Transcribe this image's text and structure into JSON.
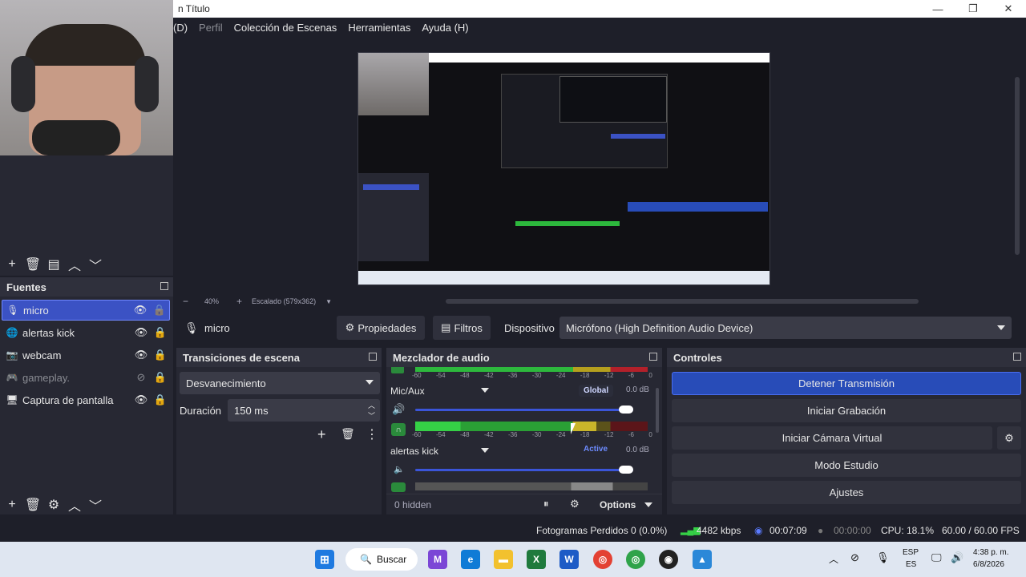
{
  "window": {
    "title": "n Título"
  },
  "menubar": {
    "items": [
      {
        "label": "(D)",
        "dim": false
      },
      {
        "label": "Perfil",
        "dim": true
      },
      {
        "label": "Colección de Escenas",
        "dim": false
      },
      {
        "label": "Herramientas",
        "dim": false
      },
      {
        "label": "Ayuda (H)",
        "dim": false
      }
    ]
  },
  "preview": {
    "zoom": "40%",
    "scale": "Escalado (579x362)"
  },
  "sources": {
    "title": "Fuentes",
    "items": [
      {
        "label": "micro",
        "icon": "mic-icon",
        "visible": true,
        "locked": false,
        "selected": true
      },
      {
        "label": "alertas kick",
        "icon": "globe-icon",
        "visible": true,
        "locked": true,
        "selected": false
      },
      {
        "label": "webcam",
        "icon": "camera-icon",
        "visible": true,
        "locked": true,
        "selected": false
      },
      {
        "label": "gameplay.",
        "icon": "gamepad-icon",
        "visible": false,
        "locked": true,
        "selected": false
      },
      {
        "label": "Captura de pantalla",
        "icon": "monitor-icon",
        "visible": true,
        "locked": true,
        "selected": false
      }
    ]
  },
  "propbar": {
    "source_name": "micro",
    "properties": "Propiedades",
    "filters": "Filtros",
    "device_label": "Dispositivo",
    "device_value": "Micrófono (High Definition Audio Device)"
  },
  "transitions": {
    "title": "Transiciones de escena",
    "type": "Desvanecimiento",
    "duration_label": "Duración",
    "duration_value": "150 ms"
  },
  "mixer": {
    "title": "Mezclador de audio",
    "ticks": [
      "-60",
      "-54",
      "-48",
      "-42",
      "-36",
      "-30",
      "-24",
      "-18",
      "-12",
      "-6",
      "0"
    ],
    "channels": [
      {
        "name": "Mic/Aux",
        "badge": "Global",
        "db": "0.0 dB",
        "level": 0.78,
        "volume": 1.0
      },
      {
        "name": "alertas kick",
        "badge": "Active",
        "db": "0.0 dB",
        "level": 0.0,
        "volume": 1.0
      }
    ],
    "hidden": "0 hidden",
    "options": "Options"
  },
  "controls": {
    "title": "Controles",
    "buttons": [
      "Detener Transmisión",
      "Iniciar Grabación",
      "Iniciar Cámara Virtual",
      "Modo Estudio",
      "Ajustes"
    ]
  },
  "status": {
    "dropped": "Fotogramas Perdidos 0 (0.0%)",
    "bitrate": "4482 kbps",
    "stream_time": "00:07:09",
    "rec_time": "00:00:00",
    "cpu": "CPU: 18.1%",
    "fps": "60.00 / 60.00 FPS"
  },
  "taskbar": {
    "search": "Buscar",
    "lang_top": "ESP",
    "lang_bottom": "ES",
    "time": "4:38 p. m.",
    "date": "6/8/2026"
  },
  "colors": {
    "accent": "#3b52c4",
    "meter_green": "#2db83d",
    "meter_yellow": "#c9b52a",
    "meter_red": "#b3202a"
  }
}
